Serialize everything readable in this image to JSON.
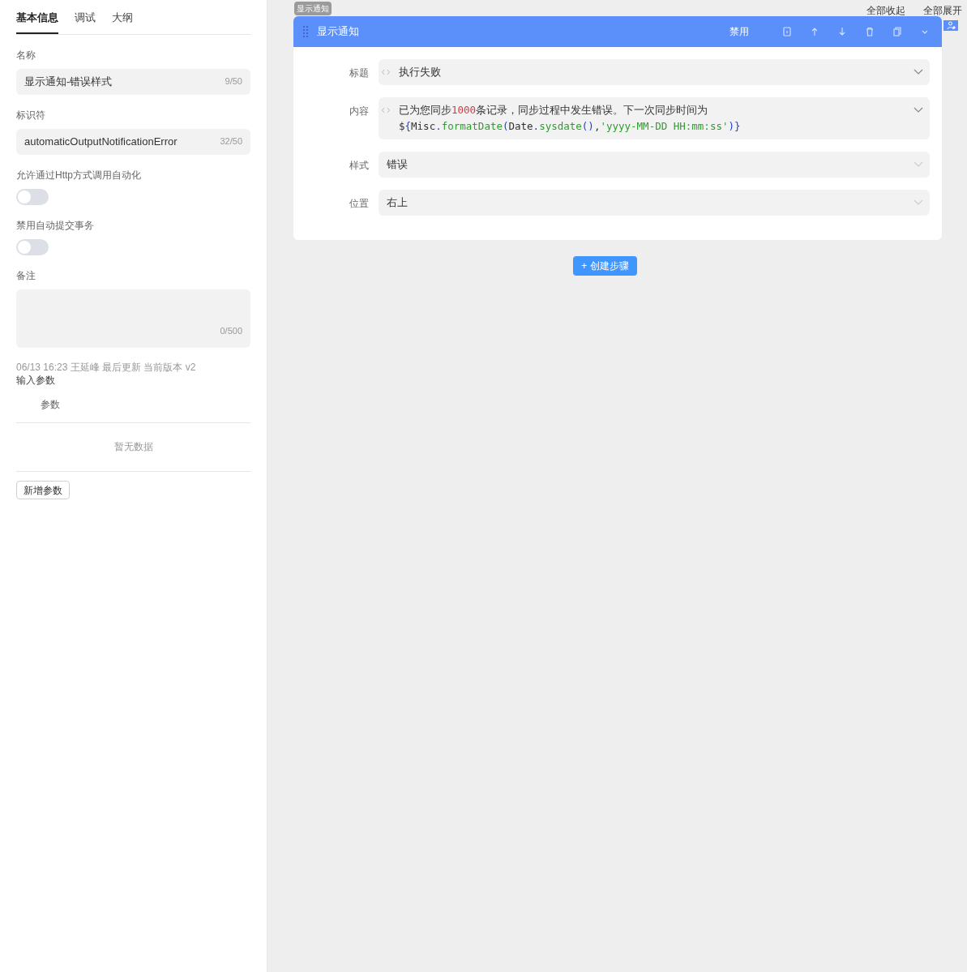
{
  "sidebar": {
    "tabs": [
      {
        "label": "基本信息",
        "selected": true
      },
      {
        "label": "调试",
        "selected": false
      },
      {
        "label": "大纲",
        "selected": false
      }
    ],
    "fields": [
      {
        "kind": "input",
        "label": "名称",
        "value": "显示通知-错误样式",
        "count": "9/50"
      },
      {
        "kind": "input",
        "label": "标识符",
        "value": "automaticOutputNotificationError",
        "count": "32/50"
      },
      {
        "kind": "switch",
        "label": "允许通过Http方式调用自动化",
        "on": false
      },
      {
        "kind": "switch",
        "label": "禁用自动提交事务",
        "on": false
      },
      {
        "kind": "textarea",
        "label": "备注",
        "count": "0/500"
      }
    ],
    "meta": "06/13 16:23 王延峰 最后更新 当前版本 v2",
    "params": {
      "title": "输入参数",
      "column": "参数",
      "empty": "暂无数据",
      "add_button": "新增参数"
    }
  },
  "toolbar": {
    "collapse_all": "全部收起",
    "expand_all": "全部展开"
  },
  "step": {
    "tag": "显示通知",
    "title": "显示通知",
    "disable_button": "禁用",
    "fields": [
      {
        "kind": "expression",
        "label": "标题",
        "lines": [
          [
            {
              "text": "执行失败",
              "kind": "plain"
            }
          ]
        ]
      },
      {
        "kind": "expression",
        "label": "内容",
        "lines": [
          [
            {
              "text": "已为您同步",
              "kind": "plain"
            },
            {
              "text": "1000",
              "kind": "number"
            },
            {
              "text": "条记录，同步过程中发生错误。下一次同步时间为",
              "kind": "plain"
            }
          ],
          [
            {
              "text": "$",
              "kind": "plain"
            },
            {
              "text": "{",
              "kind": "punct"
            },
            {
              "text": "Misc",
              "kind": "plain"
            },
            {
              "text": ".",
              "kind": "punct"
            },
            {
              "text": "formatDate",
              "kind": "func"
            },
            {
              "text": "(",
              "kind": "punct"
            },
            {
              "text": "Date",
              "kind": "plain"
            },
            {
              "text": ".",
              "kind": "punct"
            },
            {
              "text": "sysdate",
              "kind": "func"
            },
            {
              "text": "()",
              "kind": "punct"
            },
            {
              "text": ",",
              "kind": "plain"
            },
            {
              "text": "'yyyy-MM-DD HH:mm:ss'",
              "kind": "string"
            },
            {
              "text": ")}",
              "kind": "punct"
            }
          ]
        ]
      },
      {
        "kind": "select",
        "label": "样式",
        "value": "错误"
      },
      {
        "kind": "select",
        "label": "位置",
        "value": "右上"
      }
    ]
  },
  "create_step_button": "+ 创建步骤"
}
